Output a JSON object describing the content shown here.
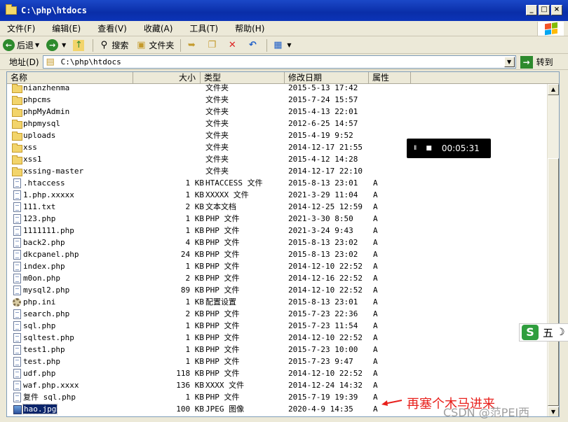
{
  "window": {
    "title": "C:\\php\\htdocs",
    "buttons": [
      "_",
      "□",
      "×"
    ]
  },
  "menu": [
    "文件(F)",
    "编辑(E)",
    "查看(V)",
    "收藏(A)",
    "工具(T)",
    "帮助(H)"
  ],
  "toolbar": {
    "back_label": "后退",
    "search_label": "搜索",
    "folders_label": "文件夹"
  },
  "address": {
    "label": "地址(D)",
    "value": "C:\\php\\htdocs",
    "go_label": "转到"
  },
  "columns": [
    "名称",
    "大小",
    "类型",
    "修改日期",
    "属性"
  ],
  "files": [
    {
      "name": "nianzhenma",
      "size": "",
      "type": "文件夹",
      "date": "2015-5-13 17:42",
      "attr": "",
      "icon": "folder"
    },
    {
      "name": "phpcms",
      "size": "",
      "type": "文件夹",
      "date": "2015-7-24 15:57",
      "attr": "",
      "icon": "folder"
    },
    {
      "name": "phpMyAdmin",
      "size": "",
      "type": "文件夹",
      "date": "2015-4-13 22:01",
      "attr": "",
      "icon": "folder"
    },
    {
      "name": "phpmysql",
      "size": "",
      "type": "文件夹",
      "date": "2012-6-25 14:57",
      "attr": "",
      "icon": "folder"
    },
    {
      "name": "uploads",
      "size": "",
      "type": "文件夹",
      "date": "2015-4-19 9:52",
      "attr": "",
      "icon": "folder"
    },
    {
      "name": "xss",
      "size": "",
      "type": "文件夹",
      "date": "2014-12-17 21:55",
      "attr": "",
      "icon": "folder"
    },
    {
      "name": "xss1",
      "size": "",
      "type": "文件夹",
      "date": "2015-4-12 14:28",
      "attr": "",
      "icon": "folder"
    },
    {
      "name": "xssing-master",
      "size": "",
      "type": "文件夹",
      "date": "2014-12-17 22:10",
      "attr": "",
      "icon": "folder"
    },
    {
      "name": ".htaccess",
      "size": "1 KB",
      "type": "HTACCESS 文件",
      "date": "2015-8-13 23:01",
      "attr": "A",
      "icon": "file"
    },
    {
      "name": "1.php.xxxxx",
      "size": "1 KB",
      "type": "XXXXX 文件",
      "date": "2021-3-29 11:04",
      "attr": "A",
      "icon": "file"
    },
    {
      "name": "111.txt",
      "size": "2 KB",
      "type": "文本文档",
      "date": "2014-12-25 12:59",
      "attr": "A",
      "icon": "file"
    },
    {
      "name": "123.php",
      "size": "1 KB",
      "type": "PHP 文件",
      "date": "2021-3-30 8:50",
      "attr": "A",
      "icon": "file"
    },
    {
      "name": "1111111.php",
      "size": "1 KB",
      "type": "PHP 文件",
      "date": "2021-3-24 9:43",
      "attr": "A",
      "icon": "file"
    },
    {
      "name": "back2.php",
      "size": "4 KB",
      "type": "PHP 文件",
      "date": "2015-8-13 23:02",
      "attr": "A",
      "icon": "file"
    },
    {
      "name": "dkcpanel.php",
      "size": "24 KB",
      "type": "PHP 文件",
      "date": "2015-8-13 23:02",
      "attr": "A",
      "icon": "file"
    },
    {
      "name": "index.php",
      "size": "1 KB",
      "type": "PHP 文件",
      "date": "2014-12-10 22:52",
      "attr": "A",
      "icon": "file"
    },
    {
      "name": "m0on.php",
      "size": "2 KB",
      "type": "PHP 文件",
      "date": "2014-12-16 22:52",
      "attr": "A",
      "icon": "file"
    },
    {
      "name": "mysql2.php",
      "size": "89 KB",
      "type": "PHP 文件",
      "date": "2014-12-10 22:52",
      "attr": "A",
      "icon": "file"
    },
    {
      "name": "php.ini",
      "size": "1 KB",
      "type": "配置设置",
      "date": "2015-8-13 23:01",
      "attr": "A",
      "icon": "gear"
    },
    {
      "name": "search.php",
      "size": "2 KB",
      "type": "PHP 文件",
      "date": "2015-7-23 22:36",
      "attr": "A",
      "icon": "file"
    },
    {
      "name": "sql.php",
      "size": "1 KB",
      "type": "PHP 文件",
      "date": "2015-7-23 11:54",
      "attr": "A",
      "icon": "file"
    },
    {
      "name": "sqltest.php",
      "size": "1 KB",
      "type": "PHP 文件",
      "date": "2014-12-10 22:52",
      "attr": "A",
      "icon": "file"
    },
    {
      "name": "test1.php",
      "size": "1 KB",
      "type": "PHP 文件",
      "date": "2015-7-23 10:00",
      "attr": "A",
      "icon": "file"
    },
    {
      "name": "test.php",
      "size": "1 KB",
      "type": "PHP 文件",
      "date": "2015-7-23 9:47",
      "attr": "A",
      "icon": "file"
    },
    {
      "name": "udf.php",
      "size": "118 KB",
      "type": "PHP 文件",
      "date": "2014-12-10 22:52",
      "attr": "A",
      "icon": "file"
    },
    {
      "name": "waf.php.xxxx",
      "size": "136 KB",
      "type": "XXXX 文件",
      "date": "2014-12-24 14:32",
      "attr": "A",
      "icon": "file"
    },
    {
      "name": "复件 sql.php",
      "size": "1 KB",
      "type": "PHP 文件",
      "date": "2015-7-19 19:39",
      "attr": "A",
      "icon": "file"
    },
    {
      "name": "hao.jpg",
      "size": "100 KB",
      "type": "JPEG 图像",
      "date": "2020-4-9 14:35",
      "attr": "A",
      "icon": "image",
      "selected": true
    }
  ],
  "media_player": {
    "pause": "II",
    "stop": "■",
    "time": "00:05:31"
  },
  "ime": {
    "logo": "S",
    "label": "五"
  },
  "annotation": {
    "text": "再塞个木马进来",
    "color": "#e8201c"
  },
  "watermark": "CSDN @范PEI西"
}
